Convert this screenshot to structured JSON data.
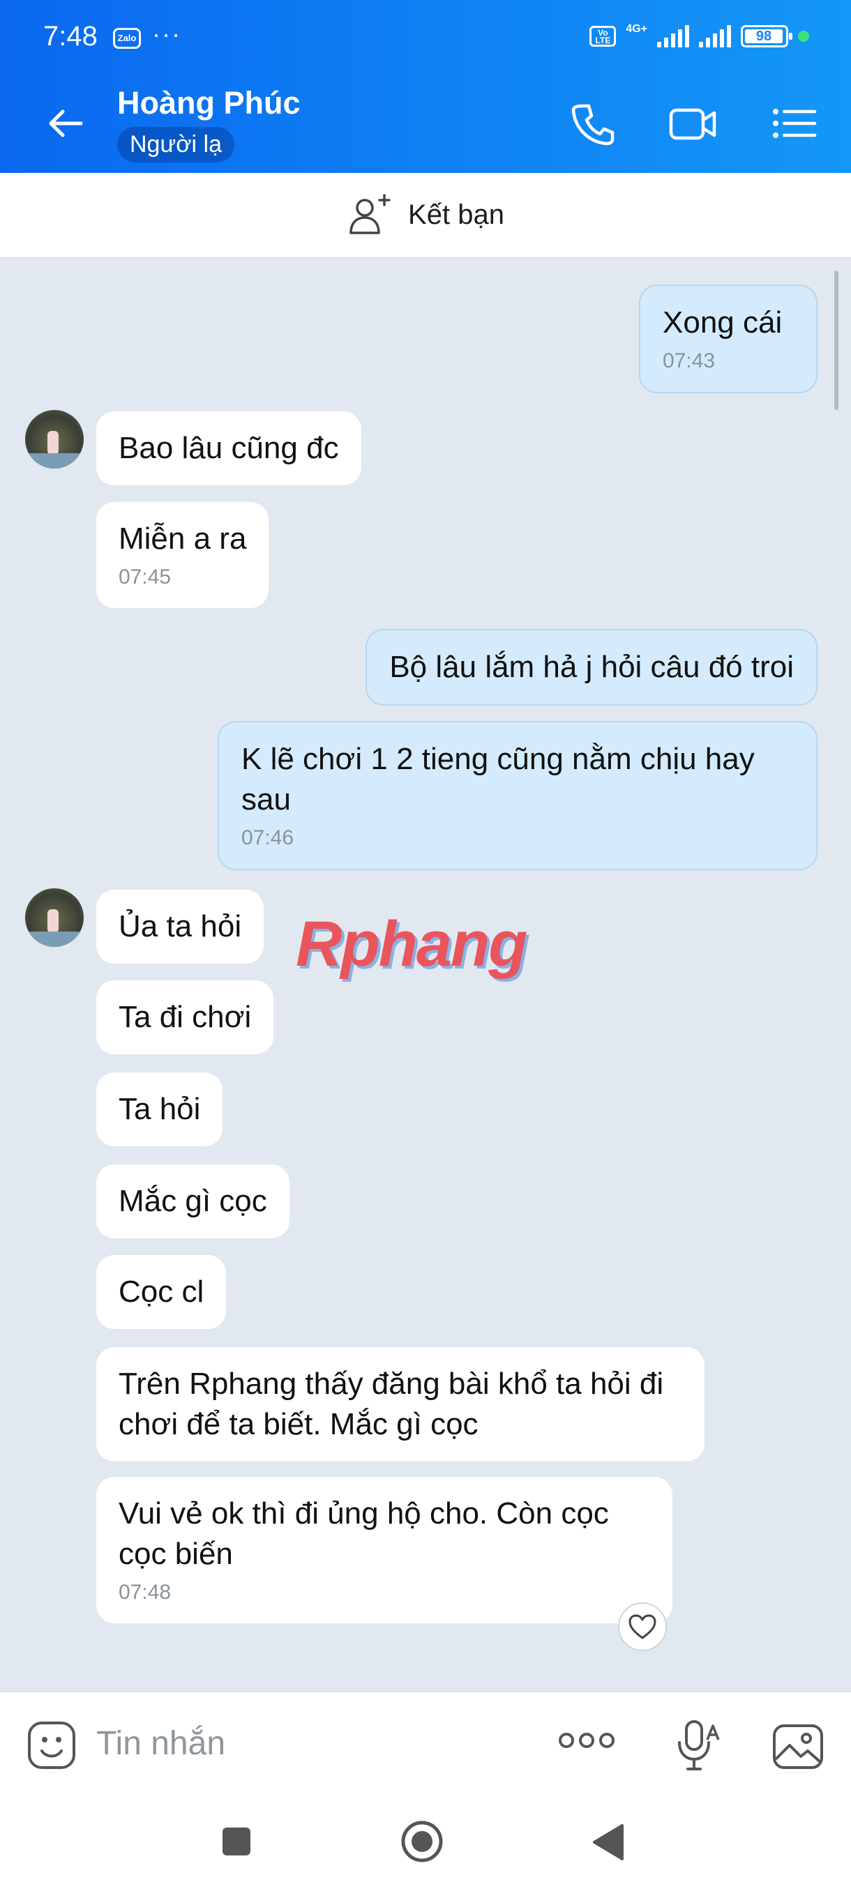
{
  "status_bar": {
    "time": "7:48",
    "app_badge": "Zalo",
    "more": "···",
    "volte": "Vo LTE",
    "network": "4G+",
    "battery": "98"
  },
  "header": {
    "name": "Hoàng Phúc",
    "tag": "Người lạ"
  },
  "add_friend": {
    "label": "Kết bạn"
  },
  "messages": [
    {
      "dir": "out",
      "text": "Xong cái",
      "time": "07:43"
    },
    {
      "dir": "in",
      "text": "Bao lâu cũng đc",
      "time": ""
    },
    {
      "dir": "in",
      "text": "Miễn a ra",
      "time": "07:45"
    },
    {
      "dir": "out",
      "text": "Bộ lâu lắm hả j hỏi câu đó troi",
      "time": ""
    },
    {
      "dir": "out",
      "text": "K lẽ chơi 1 2 tieng cũng nằm chịu hay sau",
      "time": "07:46"
    },
    {
      "dir": "in",
      "text": "Ủa ta hỏi",
      "time": ""
    },
    {
      "dir": "in",
      "text": "Ta đi chơi",
      "time": ""
    },
    {
      "dir": "in",
      "text": "Ta hỏi",
      "time": ""
    },
    {
      "dir": "in",
      "text": "Mắc gì cọc",
      "time": ""
    },
    {
      "dir": "in",
      "text": "Cọc cl",
      "time": ""
    },
    {
      "dir": "in",
      "text": "Trên Rphang thấy đăng  bài khổ ta hỏi đi chơi để ta biết. Mắc gì cọc",
      "time": ""
    },
    {
      "dir": "in",
      "text": "Vui vẻ ok thì đi ủng hộ cho. Còn cọc cọc biến",
      "time": "07:48"
    }
  ],
  "watermark": "Rphang",
  "composer": {
    "placeholder": "Tin nhắn"
  }
}
